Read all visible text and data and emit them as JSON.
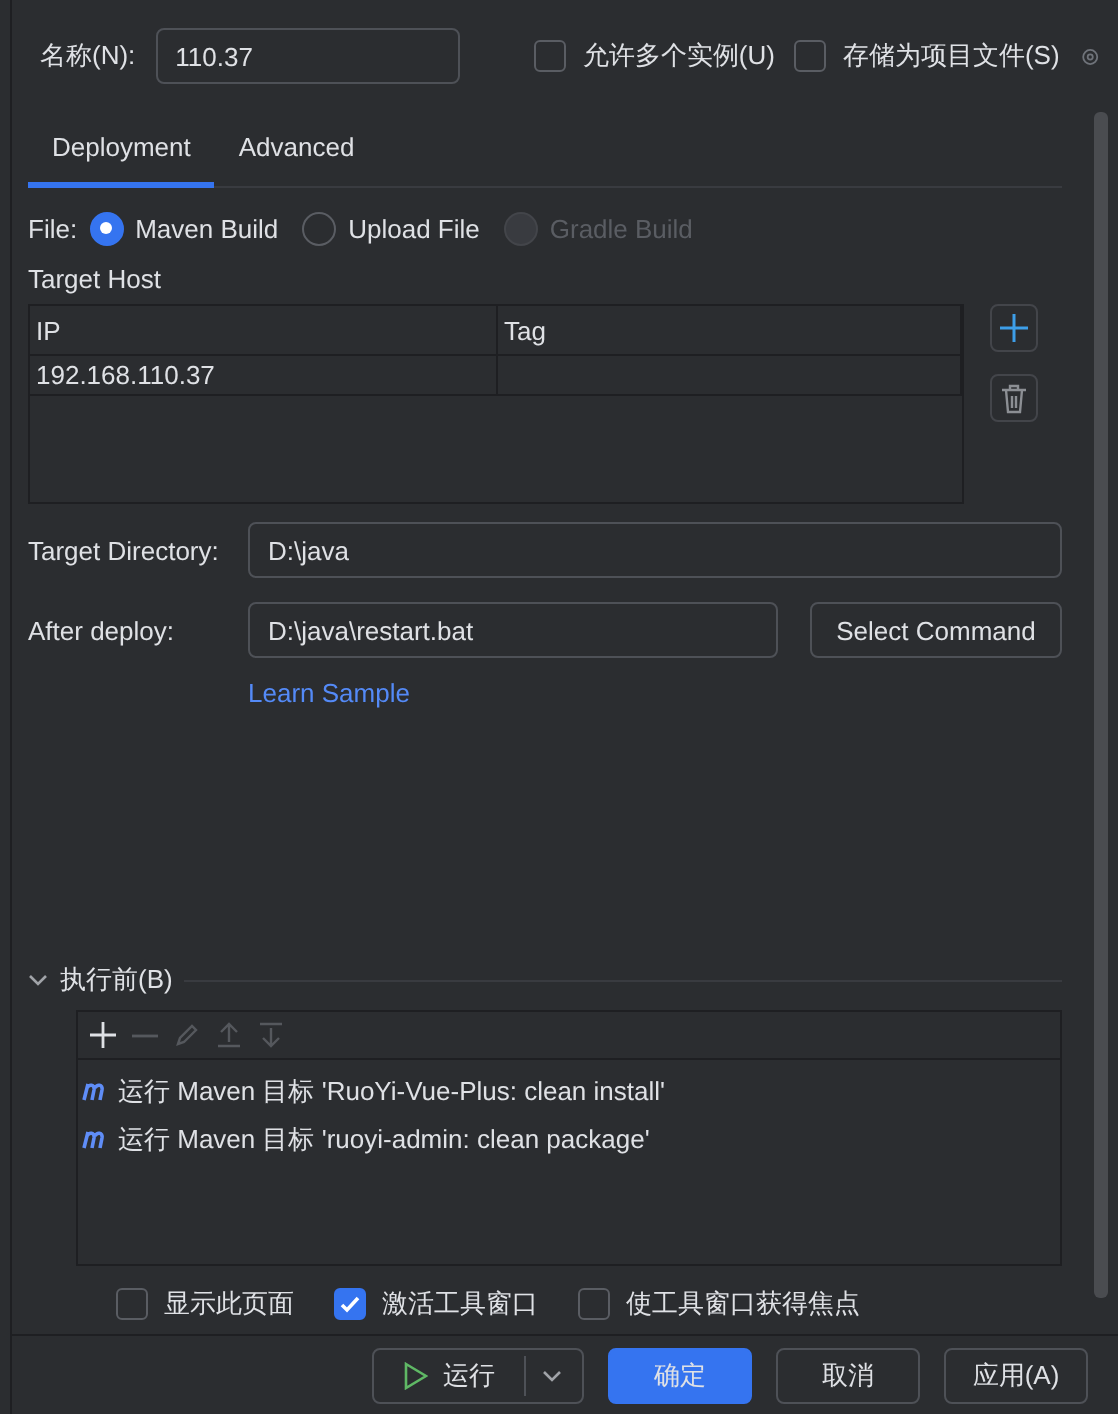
{
  "name_field": {
    "label": "名称(N):",
    "value": "110.37"
  },
  "options": [
    {
      "label": "允许多个实例(U)",
      "checked": false
    },
    {
      "label": "存储为项目文件(S)",
      "checked": false
    }
  ],
  "tabs": [
    {
      "label": "Deployment",
      "selected": true
    },
    {
      "label": "Advanced",
      "selected": false
    }
  ],
  "file": {
    "label": "File:",
    "options": [
      {
        "label": "Maven Build",
        "selected": true,
        "disabled": false
      },
      {
        "label": "Upload File",
        "selected": false,
        "disabled": false
      },
      {
        "label": "Gradle Build",
        "selected": false,
        "disabled": true
      }
    ]
  },
  "target_host": {
    "label": "Target Host",
    "columns": [
      "IP",
      "Tag"
    ],
    "rows": [
      {
        "ip": "192.168.110.37"
      }
    ]
  },
  "fields": [
    {
      "label": "Target Directory:",
      "value": "D:\\java"
    },
    {
      "label": "After deploy:",
      "value": "D:\\java\\restart.bat",
      "button": "Select Command"
    }
  ],
  "link": "Learn Sample",
  "before_launch": {
    "title": "执行前(B)",
    "expanded": true,
    "tasks": [
      "运行 Maven 目标 'RuoYi-Vue-Plus: clean install'",
      "运行 Maven 目标 'ruoyi-admin: clean package'"
    ]
  },
  "bottom_options": [
    {
      "label": "显示此页面",
      "checked": false
    },
    {
      "label": "激活工具窗口",
      "checked": true
    },
    {
      "label": "使工具窗口获得焦点",
      "checked": false
    }
  ],
  "buttons": [
    {
      "label": "运行",
      "kind": "run"
    },
    {
      "label": "确定",
      "kind": "primary"
    },
    {
      "label": "取消",
      "kind": "default"
    },
    {
      "label": "应用(A)",
      "kind": "default"
    }
  ]
}
